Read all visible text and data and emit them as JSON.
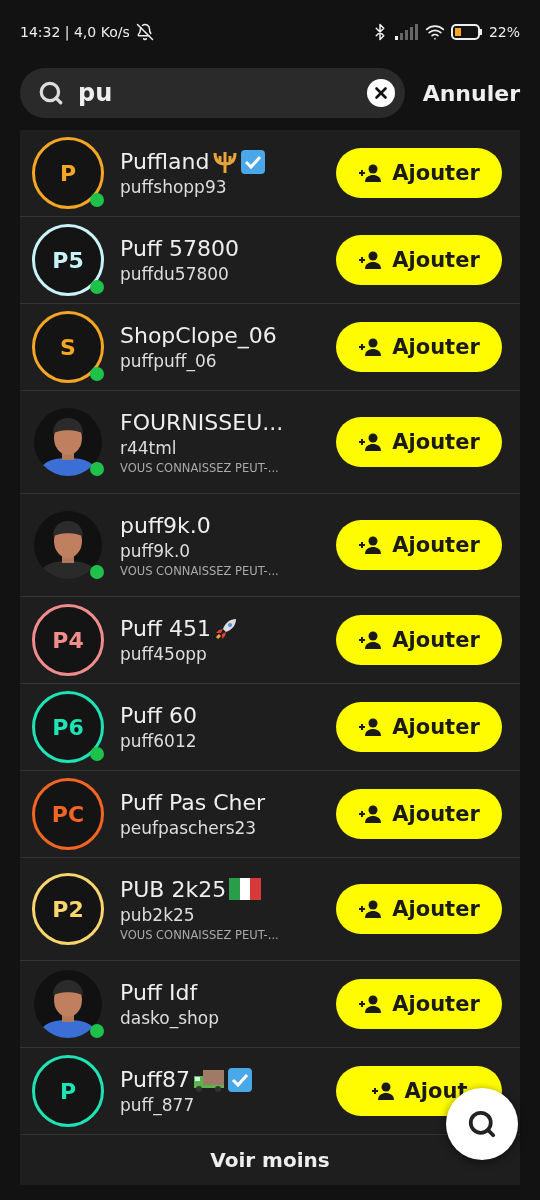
{
  "status_bar": {
    "time": "14:32 | 4,0 Ko/s",
    "battery": "22%"
  },
  "search": {
    "value": "pu",
    "cancel": "Annuler"
  },
  "results": [
    {
      "name": "Puffland",
      "badges": [
        {
          "kind": "trident"
        },
        {
          "kind": "check"
        }
      ],
      "username": "puffshopp93",
      "avatar": {
        "kind": "initials",
        "initials": "P",
        "color": "#f5a623"
      },
      "online": true,
      "button": "Ajouter"
    },
    {
      "name": "Puff 57800",
      "username": "puffdu57800",
      "avatar": {
        "kind": "initials",
        "initials": "P5",
        "color": "#c8f4f9"
      },
      "online": true,
      "button": "Ajouter"
    },
    {
      "name": "ShopClope_06",
      "username": "puffpuff_06",
      "avatar": {
        "kind": "initials",
        "initials": "S",
        "color": "#f5a623"
      },
      "online": true,
      "button": "Ajouter"
    },
    {
      "name": "FOURNISSEU...",
      "username": "r44tml",
      "hint": "VOUS CONNAISSEZ PEUT-...",
      "online": true,
      "button": "Ajouter"
    },
    {
      "name": "puff9k.0",
      "username": "puff9k.0",
      "hint": "VOUS CONNAISSEZ PEUT-...",
      "online": true,
      "button": "Ajouter"
    },
    {
      "name": "Puff 451",
      "badges": [
        {
          "kind": "rocket"
        }
      ],
      "username": "puff45opp",
      "avatar": {
        "kind": "initials",
        "initials": "P4",
        "color": "#f08c8c"
      },
      "online": false,
      "button": "Ajouter"
    },
    {
      "name": "Puff 60",
      "username": "puff6012",
      "avatar": {
        "kind": "initials",
        "initials": "P6",
        "color": "#1ee3b5"
      },
      "online": true,
      "button": "Ajouter"
    },
    {
      "name": "Puff Pas Cher",
      "username": "peufpaschers23",
      "avatar": {
        "kind": "initials",
        "initials": "PC",
        "color": "#f26522"
      },
      "online": false,
      "button": "Ajouter"
    },
    {
      "name": "PUB 2k25",
      "badges": [
        {
          "kind": "flag"
        }
      ],
      "username": "pub2k25",
      "hint": "VOUS CONNAISSEZ PEUT-...",
      "avatar": {
        "kind": "initials",
        "initials": "P2",
        "color": "#f9d56e"
      },
      "online": false,
      "button": "Ajouter"
    },
    {
      "name": "Puff Idf",
      "username": "dasko_shop",
      "online": true,
      "button": "Ajouter"
    },
    {
      "name": "Puff87",
      "badges": [
        {
          "kind": "truck"
        },
        {
          "kind": "check"
        }
      ],
      "username": "puff_877",
      "avatar": {
        "kind": "initials",
        "initials": "P",
        "color": "#1ee3b5"
      },
      "online": false,
      "button": "Ajout"
    }
  ],
  "footer": "Voir moins"
}
